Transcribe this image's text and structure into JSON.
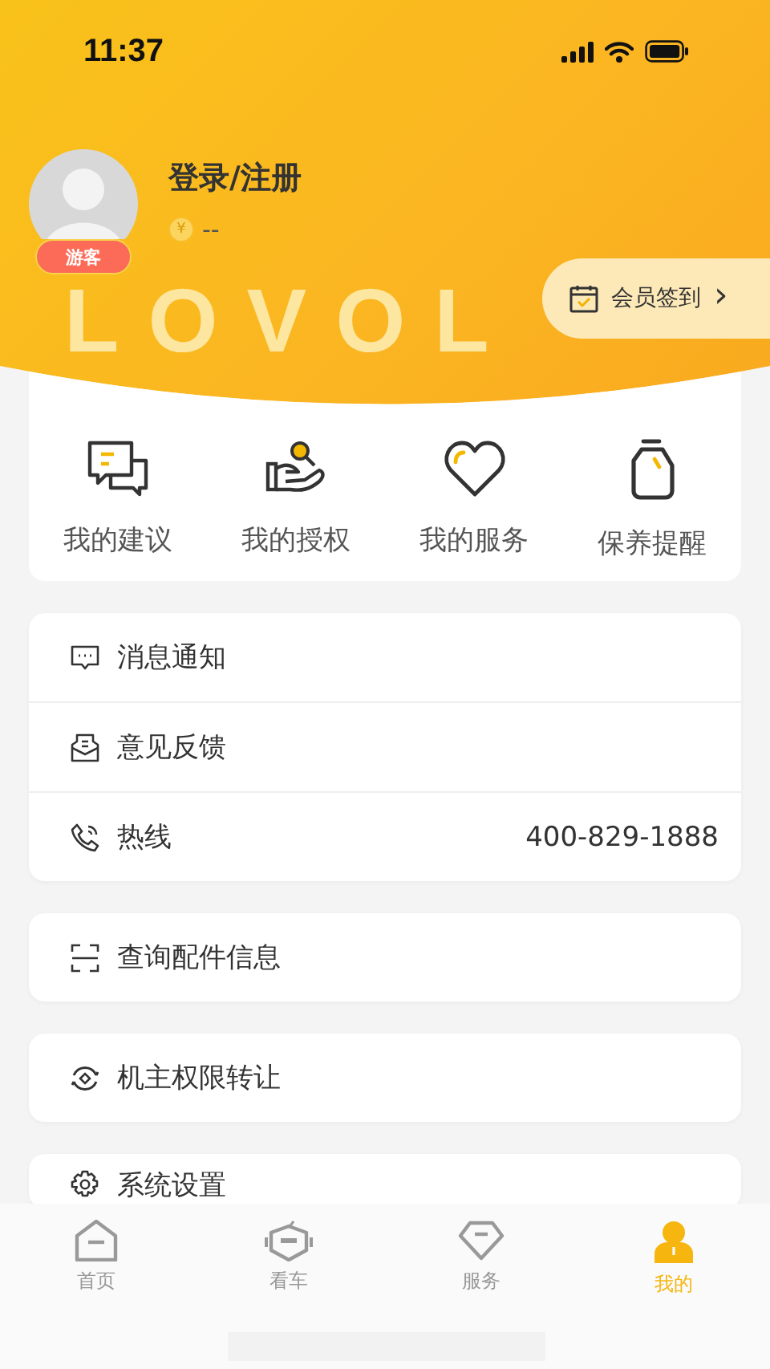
{
  "status_bar": {
    "time": "11:37"
  },
  "profile": {
    "name": "登录/注册",
    "badge": "游客",
    "coin_symbol": "¥",
    "points": "--",
    "checkin": "会员签到",
    "checkin_arrow": "›",
    "brand": "LOVOL"
  },
  "shortcuts": [
    {
      "label": "我的建议"
    },
    {
      "label": "我的授权"
    },
    {
      "label": "我的服务"
    },
    {
      "label": "保养提醒"
    }
  ],
  "menu_groups": [
    [
      {
        "label": "消息通知"
      },
      {
        "label": "意见反馈"
      },
      {
        "label": "热线",
        "value": "400-829-1888"
      }
    ],
    [
      {
        "label": "查询配件信息"
      }
    ],
    [
      {
        "label": "机主权限转让"
      }
    ],
    [
      {
        "label": "系统设置"
      }
    ]
  ],
  "tabs": [
    {
      "label": "首页",
      "selected": false
    },
    {
      "label": "看车",
      "selected": false
    },
    {
      "label": "服务",
      "selected": false
    },
    {
      "label": "我的",
      "selected": true
    }
  ]
}
